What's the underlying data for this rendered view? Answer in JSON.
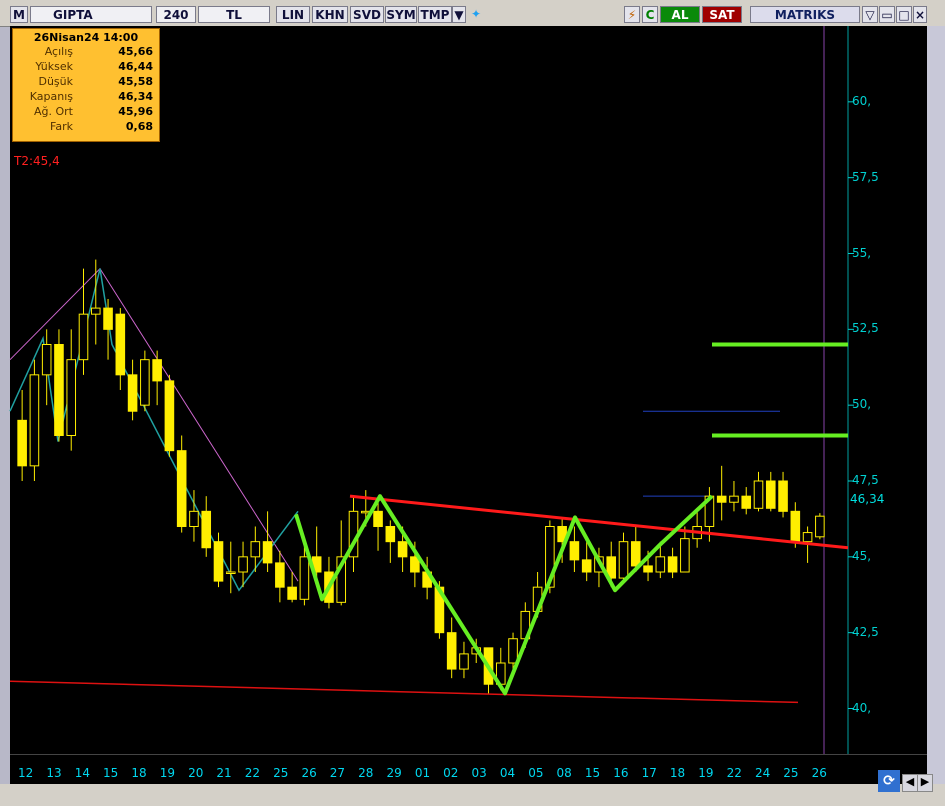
{
  "toolbar": {
    "symbol": "GIPTA",
    "period": "240",
    "currency": "TL",
    "buttons": [
      "LIN",
      "KHN",
      "SVD",
      "SYM",
      "TMP"
    ],
    "buy": "AL",
    "sell": "SAT",
    "brand": "MATRIKS",
    "logo_letter": "M",
    "c_label": "C"
  },
  "info": {
    "date": "26Nisan24 14:00",
    "rows": [
      {
        "k": "Açılış",
        "v": "45,66"
      },
      {
        "k": "Yüksek",
        "v": "46,44"
      },
      {
        "k": "Düşük",
        "v": "45,58"
      },
      {
        "k": "Kapanış",
        "v": "46,34"
      },
      {
        "k": "Ağ. Ort",
        "v": "45,96"
      },
      {
        "k": "Fark",
        "v": "0,68"
      }
    ]
  },
  "t2_label": "T2:45,4",
  "last_price_label": "46,34",
  "colors": {
    "bull": "#ffee00",
    "bear": "#ffee00",
    "pattern": "#66ee22",
    "neckline": "#ff1a1a",
    "support": "#dd1111",
    "zigzag": "#cc66cc",
    "axis": "#00d0d0"
  },
  "chart_data": {
    "type": "candlestick",
    "ylim": [
      38.5,
      62.5
    ],
    "y_ticks": [
      "60,",
      "57,5",
      "55,",
      "52,5",
      "50,",
      "47,5",
      "45,",
      "42,5",
      "40,"
    ],
    "y_tick_values": [
      60,
      57.5,
      55,
      52.5,
      50,
      47.5,
      45,
      42.5,
      40
    ],
    "x_labels": [
      "12",
      "13",
      "14",
      "15",
      "18",
      "19",
      "20",
      "21",
      "22",
      "25",
      "26",
      "27",
      "28",
      "29",
      "01",
      "02",
      "03",
      "04",
      "05",
      "08",
      "15",
      "16",
      "17",
      "18",
      "19",
      "22",
      "24",
      "25",
      "26"
    ],
    "candles": [
      [
        49.5,
        48.0,
        50.5,
        47.5
      ],
      [
        48.0,
        51.0,
        51.5,
        47.5
      ],
      [
        51.0,
        52.0,
        52.5,
        50.0
      ],
      [
        52.0,
        49.0,
        52.5,
        48.8
      ],
      [
        49.0,
        51.5,
        52.5,
        48.5
      ],
      [
        51.5,
        53.0,
        54.5,
        51.0
      ],
      [
        53.0,
        53.2,
        54.8,
        52.0
      ],
      [
        53.2,
        52.5,
        53.5,
        51.5
      ],
      [
        53.0,
        51.0,
        53.2,
        50.5
      ],
      [
        51.0,
        49.8,
        51.5,
        49.5
      ],
      [
        50.0,
        51.5,
        51.8,
        49.8
      ],
      [
        51.5,
        50.8,
        51.8,
        50.0
      ],
      [
        50.8,
        48.5,
        51.0,
        48.3
      ],
      [
        48.5,
        46.0,
        49.0,
        45.8
      ],
      [
        46.0,
        46.5,
        47.2,
        45.5
      ],
      [
        46.5,
        45.3,
        47.0,
        45.0
      ],
      [
        45.5,
        44.2,
        45.8,
        44.0
      ],
      [
        44.5,
        44.5,
        45.5,
        43.8
      ],
      [
        44.5,
        45.0,
        45.5,
        44.0
      ],
      [
        45.0,
        45.5,
        46.0,
        44.5
      ],
      [
        45.5,
        44.8,
        46.5,
        44.5
      ],
      [
        44.8,
        44.0,
        45.2,
        43.5
      ],
      [
        44.0,
        43.6,
        44.5,
        43.5
      ],
      [
        43.6,
        45.0,
        45.5,
        43.4
      ],
      [
        45.0,
        44.5,
        46.0,
        44.2
      ],
      [
        44.5,
        43.5,
        45.0,
        43.3
      ],
      [
        43.5,
        45.0,
        46.2,
        43.4
      ],
      [
        45.0,
        46.5,
        47.0,
        44.5
      ],
      [
        46.5,
        46.5,
        47.2,
        46.0
      ],
      [
        46.5,
        46.0,
        46.8,
        45.2
      ],
      [
        46.0,
        45.5,
        46.2,
        44.8
      ],
      [
        45.5,
        45.0,
        46.0,
        44.5
      ],
      [
        45.0,
        44.5,
        45.5,
        44.0
      ],
      [
        44.5,
        44.0,
        45.0,
        43.6
      ],
      [
        44.0,
        42.5,
        44.2,
        42.3
      ],
      [
        42.5,
        41.3,
        43.0,
        41.0
      ],
      [
        41.3,
        41.8,
        42.2,
        41.0
      ],
      [
        41.8,
        42.0,
        42.3,
        41.5
      ],
      [
        42.0,
        40.8,
        42.0,
        40.5
      ],
      [
        40.8,
        41.5,
        42.0,
        40.6
      ],
      [
        41.5,
        42.3,
        42.5,
        41.2
      ],
      [
        42.3,
        43.2,
        43.5,
        42.0
      ],
      [
        43.2,
        44.0,
        44.5,
        43.0
      ],
      [
        44.0,
        46.0,
        46.2,
        43.8
      ],
      [
        46.0,
        45.5,
        46.3,
        44.8
      ],
      [
        45.5,
        44.9,
        46.0,
        44.5
      ],
      [
        44.9,
        44.5,
        45.5,
        44.2
      ],
      [
        44.5,
        45.0,
        45.3,
        44.0
      ],
      [
        45.0,
        44.3,
        45.5,
        44.0
      ],
      [
        44.3,
        45.5,
        45.8,
        44.2
      ],
      [
        45.5,
        44.7,
        46.0,
        44.5
      ],
      [
        44.7,
        44.5,
        45.2,
        44.2
      ],
      [
        44.5,
        45.0,
        45.5,
        44.3
      ],
      [
        45.0,
        44.5,
        45.3,
        44.3
      ],
      [
        44.5,
        45.6,
        46.0,
        44.5
      ],
      [
        45.6,
        46.0,
        46.5,
        45.3
      ],
      [
        46.0,
        47.0,
        47.3,
        45.5
      ],
      [
        47.0,
        46.8,
        48.0,
        46.2
      ],
      [
        46.8,
        47.0,
        47.5,
        46.5
      ],
      [
        47.0,
        46.6,
        47.3,
        46.4
      ],
      [
        46.6,
        47.5,
        47.8,
        46.5
      ],
      [
        47.5,
        46.6,
        47.8,
        46.5
      ],
      [
        47.5,
        46.5,
        47.8,
        46.3
      ],
      [
        46.5,
        45.5,
        46.8,
        45.3
      ],
      [
        45.5,
        45.8,
        46.0,
        44.8
      ],
      [
        45.66,
        46.34,
        46.44,
        45.58
      ]
    ],
    "neckline": {
      "from": [
        350,
        47.0
      ],
      "to": [
        848,
        45.3
      ]
    },
    "support_line": {
      "from": [
        10,
        40.9
      ],
      "to": [
        798,
        40.2
      ]
    },
    "targets": [
      {
        "x0": 712,
        "x1": 848,
        "y": 52.0
      },
      {
        "x0": 712,
        "x1": 848,
        "y": 49.0
      }
    ],
    "blue_lines": [
      {
        "x0": 643,
        "x1": 780,
        "y": 49.8
      },
      {
        "x0": 643,
        "x1": 712,
        "y": 47.0
      }
    ],
    "pattern_points": [
      [
        296,
        46.4
      ],
      [
        322,
        43.6
      ],
      [
        380,
        47.0
      ],
      [
        505,
        40.5
      ],
      [
        575,
        46.3
      ],
      [
        615,
        43.9
      ],
      [
        660,
        45.4
      ],
      [
        712,
        47.0
      ]
    ],
    "zigzag_points": [
      [
        10,
        51.5
      ],
      [
        100,
        54.5
      ],
      [
        298,
        44.2
      ]
    ],
    "zigzag2_points": [
      [
        10,
        49.8
      ],
      [
        43,
        52.2
      ],
      [
        58,
        48.8
      ],
      [
        100,
        54.5
      ],
      [
        112,
        52.0
      ],
      [
        239,
        43.9
      ],
      [
        298,
        46.5
      ]
    ]
  }
}
